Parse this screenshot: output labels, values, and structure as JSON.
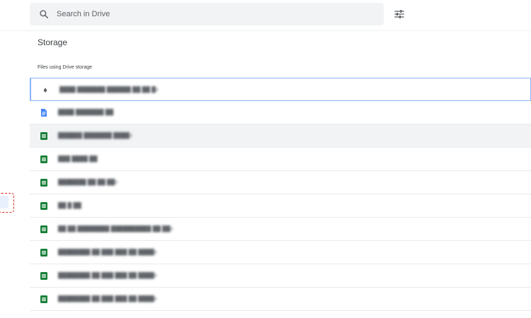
{
  "search": {
    "placeholder": "Search in Drive",
    "icon": "search-icon",
    "options_icon": "tune-icon"
  },
  "page": {
    "title": "Storage",
    "section_label": "Files using Drive storage"
  },
  "colors": {
    "sheets_green": "#188038",
    "docs_blue": "#4285f4",
    "selection_blue": "#8ab4f8",
    "focus_red": "#d93025"
  },
  "files": [
    {
      "type": "generic",
      "icon": "generic-file-icon",
      "name": "████ ███████ ██████ ██ ██ █x"
    },
    {
      "type": "document",
      "icon": "google-docs-icon",
      "name": "████ ███████ ██"
    },
    {
      "type": "spreadsheet",
      "icon": "google-sheets-icon",
      "name": "██████ ███████ ████x"
    },
    {
      "type": "spreadsheet",
      "icon": "google-sheets-icon",
      "name": "███ ████ ██"
    },
    {
      "type": "spreadsheet",
      "icon": "google-sheets-icon",
      "name": "███████ ██ ██ ██x"
    },
    {
      "type": "spreadsheet",
      "icon": "google-sheets-icon",
      "name": "██ █ ██"
    },
    {
      "type": "spreadsheet",
      "icon": "google-sheets-icon",
      "name": "██ ██ ████████ ██████████ ██ ██x"
    },
    {
      "type": "spreadsheet",
      "icon": "google-sheets-icon",
      "name": "████████ ██ ███ ███ ██ ████x"
    },
    {
      "type": "spreadsheet",
      "icon": "google-sheets-icon",
      "name": "████████ ██ ███ ███ ██ ████x"
    },
    {
      "type": "spreadsheet",
      "icon": "google-sheets-icon",
      "name": "████████ ██ ███ ███ ██ ████x"
    }
  ]
}
